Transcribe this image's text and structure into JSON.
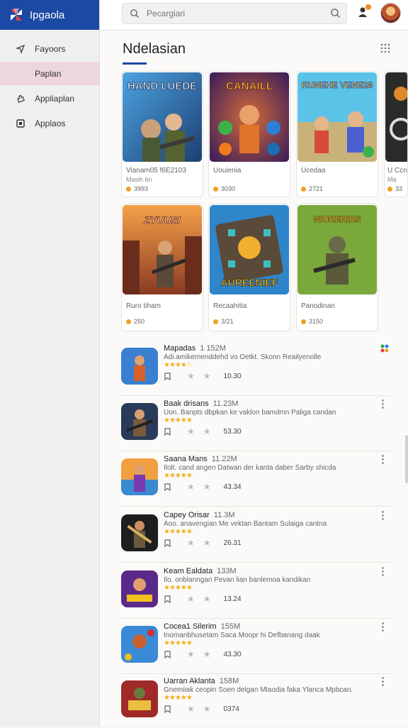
{
  "app": {
    "title": "Ipgaola",
    "logo_icon": "pinwheel-logo-icon"
  },
  "sidebar": {
    "items": [
      {
        "label": "Fayoors",
        "icon": "navigation-arrow-icon",
        "active": false
      },
      {
        "label": "Paplan",
        "icon": "none",
        "active": true
      },
      {
        "label": "Appliaplan",
        "icon": "puzzle-icon",
        "active": false
      },
      {
        "label": "Applaos",
        "icon": "app-square-icon",
        "active": false
      }
    ]
  },
  "header": {
    "search_placeholder": "Pecargiari",
    "notification_icon": "user-alert-icon",
    "avatar": "avatar"
  },
  "main": {
    "section_title": "Ndelasian",
    "featured": [
      {
        "art_title": "HAND LUEDE",
        "name": "Vianam05 f6E2103",
        "sub": "Masih 6n",
        "meta": "3993"
      },
      {
        "art_title": "CANAILL",
        "name": "Uouienia",
        "sub": "",
        "meta": "3030"
      },
      {
        "art_title": "RUNEHE VENE28",
        "name": "Ucedaa",
        "sub": "",
        "meta": "2721"
      },
      {
        "art_title": "",
        "name": "U Ccn",
        "sub": "Ma",
        "meta": "33"
      },
      {
        "art_title": "ZYUUSI",
        "name": "Ruro tiham",
        "sub": "",
        "meta": "250"
      },
      {
        "art_title": "AUREENIEF",
        "name": "Recaahitia",
        "sub": "",
        "meta": "3/21"
      },
      {
        "art_title": "NIORERIRS",
        "name": "Panodinan",
        "sub": "",
        "meta": "3150"
      }
    ],
    "list": [
      {
        "title": "Mapadas",
        "size": "1 152M",
        "desc": "Adi.amikemenddehd vo Oetkt. Skonn Reailyenolle",
        "stars": "★★★★☆",
        "number": "10.30"
      },
      {
        "title": "Baak drisans",
        "size": "11.23M",
        "desc": "Uon. Banpts dbpkan ke vaklon bamdmn Paliga candan",
        "stars": "★★★★★",
        "number": "53.30"
      },
      {
        "title": "Saana Mans",
        "size": "11.22M",
        "desc": "Ilolt. cand angen Datwan der kanta daber Sarby shicda",
        "stars": "★★★★★",
        "number": "43.34"
      },
      {
        "title": "Capey Orisar",
        "size": "11.3M",
        "desc": "Aoo. anavengian Me vektan Bantam Sulaiga cantna",
        "stars": "★★★★★",
        "number": "26.31"
      },
      {
        "title": "Keam Ealdata",
        "size": "133M",
        "desc": "Ilo. onblanngan Pevan lian banlemoa kandikan",
        "stars": "★★★★★",
        "number": "13.24"
      },
      {
        "title": "Cocea1 Silerim",
        "size": "155M",
        "desc": "Inomanbhusetam Saca Moopr hi Defbanang daak",
        "stars": "★★★★★",
        "number": "43.30"
      },
      {
        "title": "Uarran Aklanta",
        "size": "158M",
        "desc": "Gnemiiak ceopin Soen delgan Mlaodia faka Ylanca Mpbcan.",
        "stars": "★★★★★",
        "number": "0374"
      }
    ]
  },
  "colors": {
    "brand": "#1b4aa5",
    "active_nav": "#edd6dc",
    "star": "#f2b01e"
  }
}
